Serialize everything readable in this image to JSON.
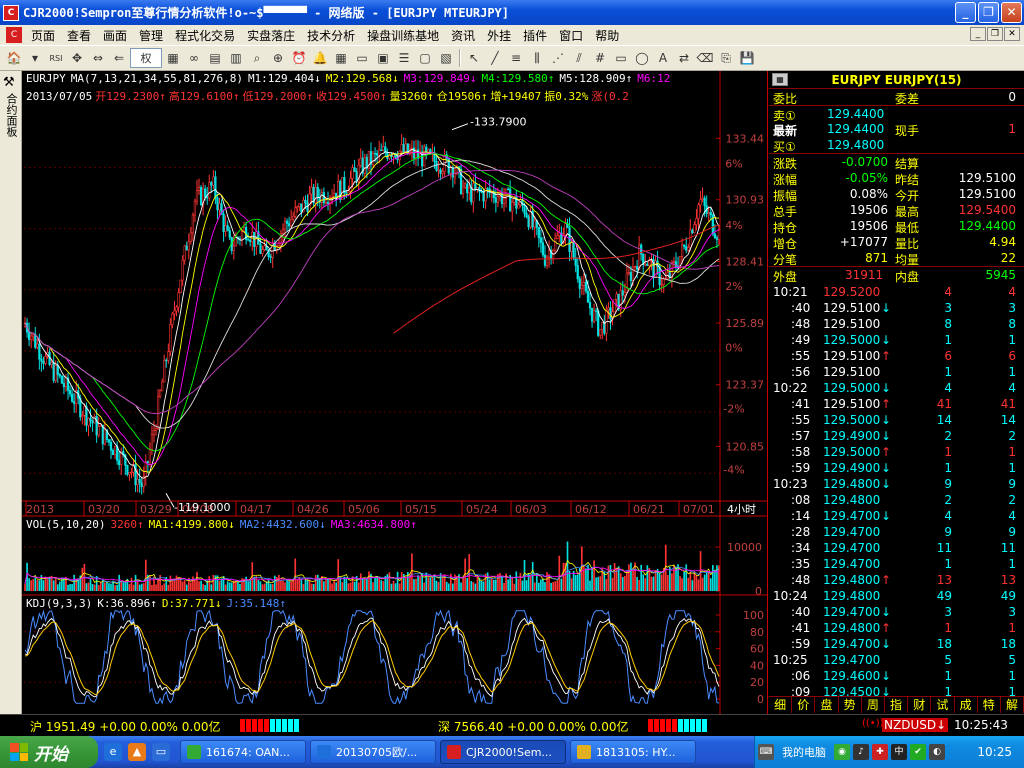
{
  "window": {
    "title": "CJR2000!Sempron至尊行情分析软件!o-~$▀▀▀▀▀▀  -  网络版  -  [EURJPY MTEURJPY]",
    "app_icon": "chart-app-icon"
  },
  "menu": [
    "页面",
    "查看",
    "画面",
    "管理",
    "程式化交易",
    "实盘落庄",
    "技术分析",
    "操盘训练基地",
    "资讯",
    "外挂",
    "插件",
    "窗口",
    "帮助"
  ],
  "toolbar": {
    "combo_label": "权"
  },
  "left_strip": {
    "label": "合约面板"
  },
  "main_chart": {
    "ma_header": [
      {
        "text": "EURJPY",
        "color": "#ffffff"
      },
      {
        "text": "MA(7,13,21,34,55,81,276,8)",
        "color": "#ffffff"
      },
      {
        "text": "M1:129.404↓",
        "color": "#ffffff"
      },
      {
        "text": "M2:129.568↓",
        "color": "#ffff00"
      },
      {
        "text": "M3:129.849↓",
        "color": "#ff00ff"
      },
      {
        "text": "M4:129.580↑",
        "color": "#00ff00"
      },
      {
        "text": "M5:128.909↑",
        "color": "#ffffff"
      },
      {
        "text": "M6:12",
        "color": "#ff00ff"
      }
    ],
    "info_header": [
      {
        "text": "2013/07/05",
        "color": "#ffffff"
      },
      {
        "text": "开129.2300↑",
        "color": "#ff3333"
      },
      {
        "text": "高129.6100↑",
        "color": "#ff3333"
      },
      {
        "text": "低129.2000↑",
        "color": "#ff3333"
      },
      {
        "text": "收129.4500↑",
        "color": "#ff3333"
      },
      {
        "text": "量3260↑",
        "color": "#ffff00"
      },
      {
        "text": "仓19506↑",
        "color": "#ffff00"
      },
      {
        "text": "增+19407",
        "color": "#ffff00"
      },
      {
        "text": "振0.32%",
        "color": "#ffff00"
      },
      {
        "text": "涨(0.2",
        "color": "#ff3333"
      }
    ],
    "price_axis": [
      "133.44",
      "130.93",
      "128.41",
      "125.89",
      "123.37",
      "120.85"
    ],
    "pct_axis": [
      "6%",
      "4%",
      "2%",
      "0%",
      "-2%",
      "-4%"
    ],
    "high_label": "133.7900",
    "low_label": "119.1000",
    "date_axis": [
      "2013",
      "03/20",
      "03/29",
      "04/08",
      "04/17",
      "04/26",
      "05/06",
      "05/15",
      "05/24",
      "06/03",
      "06/12",
      "06/21",
      "07/01"
    ],
    "period": "4小时"
  },
  "vol_chart": {
    "header": [
      {
        "text": "VOL(5,10,20)",
        "color": "#ffffff"
      },
      {
        "text": "3260↑",
        "color": "#ff3333"
      },
      {
        "text": "MA1:4199.800↓",
        "color": "#ffff00"
      },
      {
        "text": "MA2:4432.600↓",
        "color": "#4a8cff"
      },
      {
        "text": "MA3:4634.800↑",
        "color": "#ff00ff"
      }
    ],
    "axis": [
      "10000",
      "0"
    ]
  },
  "kdj_chart": {
    "header": [
      {
        "text": "KDJ(9,3,3)",
        "color": "#ffffff"
      },
      {
        "text": "K:36.896↑",
        "color": "#ffffff"
      },
      {
        "text": "D:37.771↓",
        "color": "#ffff00"
      },
      {
        "text": "J:35.148↑",
        "color": "#4a8cff"
      }
    ],
    "axis": [
      "100",
      "80",
      "60",
      "40",
      "20",
      "0"
    ]
  },
  "quote": {
    "title": "EURJPY EURJPY(15)",
    "wb_label": "委比",
    "wc_label": "委差",
    "wc_value": "0",
    "sell_label": "卖①",
    "sell_price": "129.4400",
    "last_label": "最新",
    "last_price": "129.4400",
    "now_vol_label": "现手",
    "now_vol": "1",
    "buy_label": "买①",
    "buy_price": "129.4800",
    "rows": [
      {
        "l1": "涨跌",
        "v1": "-0.0700",
        "c1": "gr",
        "l2": "结算",
        "v2": "",
        "c2": "wh"
      },
      {
        "l1": "涨幅",
        "v1": "-0.05%",
        "c1": "gr",
        "l2": "昨结",
        "v2": "129.5100",
        "c2": "wh"
      },
      {
        "l1": "振幅",
        "v1": "0.08%",
        "c1": "wh",
        "l2": "今开",
        "v2": "129.5100",
        "c2": "wh"
      },
      {
        "l1": "总手",
        "v1": "19506",
        "c1": "wh",
        "l2": "最高",
        "v2": "129.5400",
        "c2": "rd"
      },
      {
        "l1": "持仓",
        "v1": "19506",
        "c1": "wh",
        "l2": "最低",
        "v2": "129.4400",
        "c2": "gr"
      },
      {
        "l1": "增仓",
        "v1": "+17077",
        "c1": "wh",
        "l2": "量比",
        "v2": "4.94",
        "c2": "yl"
      },
      {
        "l1": "分笔",
        "v1": "871",
        "c1": "yl",
        "l2": "均量",
        "v2": "22",
        "c2": "yl"
      }
    ],
    "outer_label": "外盘",
    "outer_value": "31911",
    "inner_label": "内盘",
    "inner_value": "5945"
  },
  "ticks": [
    {
      "t": "10:21",
      "tc": "wh",
      "p": "129.5200",
      "pc": "rd",
      "a": "",
      "v": "4",
      "m": "4"
    },
    {
      "t": ":40",
      "tc": "wh",
      "p": "129.5100",
      "pc": "wh",
      "a": "↓",
      "v": "3",
      "m": "3"
    },
    {
      "t": ":48",
      "tc": "wh",
      "p": "129.5100",
      "pc": "wh",
      "a": "",
      "v": "8",
      "m": "8"
    },
    {
      "t": ":49",
      "tc": "wh",
      "p": "129.5000",
      "pc": "cy",
      "a": "↓",
      "v": "1",
      "m": "1"
    },
    {
      "t": ":55",
      "tc": "wh",
      "p": "129.5100",
      "pc": "wh",
      "a": "↑",
      "v": "6",
      "m": "6"
    },
    {
      "t": ":56",
      "tc": "wh",
      "p": "129.5100",
      "pc": "wh",
      "a": "",
      "v": "1",
      "m": "1"
    },
    {
      "t": "10:22",
      "tc": "wh",
      "p": "129.5000",
      "pc": "cy",
      "a": "↓",
      "v": "4",
      "m": "4"
    },
    {
      "t": ":41",
      "tc": "wh",
      "p": "129.5100",
      "pc": "wh",
      "a": "↑",
      "v": "41",
      "m": "41"
    },
    {
      "t": ":55",
      "tc": "wh",
      "p": "129.5000",
      "pc": "cy",
      "a": "↓",
      "v": "14",
      "m": "14"
    },
    {
      "t": ":57",
      "tc": "wh",
      "p": "129.4900",
      "pc": "cy",
      "a": "↓",
      "v": "2",
      "m": "2"
    },
    {
      "t": ":58",
      "tc": "wh",
      "p": "129.5000",
      "pc": "cy",
      "a": "↑",
      "v": "1",
      "m": "1"
    },
    {
      "t": ":59",
      "tc": "wh",
      "p": "129.4900",
      "pc": "cy",
      "a": "↓",
      "v": "1",
      "m": "1"
    },
    {
      "t": "10:23",
      "tc": "wh",
      "p": "129.4800",
      "pc": "cy",
      "a": "↓",
      "v": "9",
      "m": "9"
    },
    {
      "t": ":08",
      "tc": "wh",
      "p": "129.4800",
      "pc": "cy",
      "a": "",
      "v": "2",
      "m": "2"
    },
    {
      "t": ":14",
      "tc": "wh",
      "p": "129.4700",
      "pc": "cy",
      "a": "↓",
      "v": "4",
      "m": "4"
    },
    {
      "t": ":28",
      "tc": "wh",
      "p": "129.4700",
      "pc": "cy",
      "a": "",
      "v": "9",
      "m": "9"
    },
    {
      "t": ":34",
      "tc": "wh",
      "p": "129.4700",
      "pc": "cy",
      "a": "",
      "v": "11",
      "m": "11"
    },
    {
      "t": ":35",
      "tc": "wh",
      "p": "129.4700",
      "pc": "cy",
      "a": "",
      "v": "1",
      "m": "1"
    },
    {
      "t": ":48",
      "tc": "wh",
      "p": "129.4800",
      "pc": "cy",
      "a": "↑",
      "v": "13",
      "m": "13"
    },
    {
      "t": "10:24",
      "tc": "wh",
      "p": "129.4800",
      "pc": "cy",
      "a": "",
      "v": "49",
      "m": "49"
    },
    {
      "t": ":40",
      "tc": "wh",
      "p": "129.4700",
      "pc": "cy",
      "a": "↓",
      "v": "3",
      "m": "3"
    },
    {
      "t": ":41",
      "tc": "wh",
      "p": "129.4800",
      "pc": "cy",
      "a": "↑",
      "v": "1",
      "m": "1"
    },
    {
      "t": ":59",
      "tc": "wh",
      "p": "129.4700",
      "pc": "cy",
      "a": "↓",
      "v": "18",
      "m": "18"
    },
    {
      "t": "10:25",
      "tc": "wh",
      "p": "129.4700",
      "pc": "cy",
      "a": "",
      "v": "5",
      "m": "5"
    },
    {
      "t": ":06",
      "tc": "wh",
      "p": "129.4600",
      "pc": "cy",
      "a": "↓",
      "v": "1",
      "m": "1"
    },
    {
      "t": ":09",
      "tc": "wh",
      "p": "129.4500",
      "pc": "cy",
      "a": "↓",
      "v": "1",
      "m": "1"
    }
  ],
  "right_tabs": [
    "细",
    "价",
    "盘",
    "势",
    "周",
    "指",
    "财",
    "试",
    "成",
    "特",
    "解"
  ],
  "index_bar": {
    "sh": "沪 1951.49 +0.00 0.00% 0.00亿",
    "sz": "深 7566.40 +0.00 0.00% 0.00亿",
    "symbol": "NZDUSD↓",
    "time": "10:25:43"
  },
  "taskbar": {
    "start": "开始",
    "tasks": [
      "161674: OAN...",
      "20130705欧/...",
      "CJR2000!Sem...",
      "1813105: HY..."
    ],
    "tray_label": "我的电脑",
    "clock": "10:25"
  },
  "colors": {
    "up": "#ff3333",
    "down": "#00ffff",
    "axis": "#c00000",
    "accent": "#ffff00"
  }
}
